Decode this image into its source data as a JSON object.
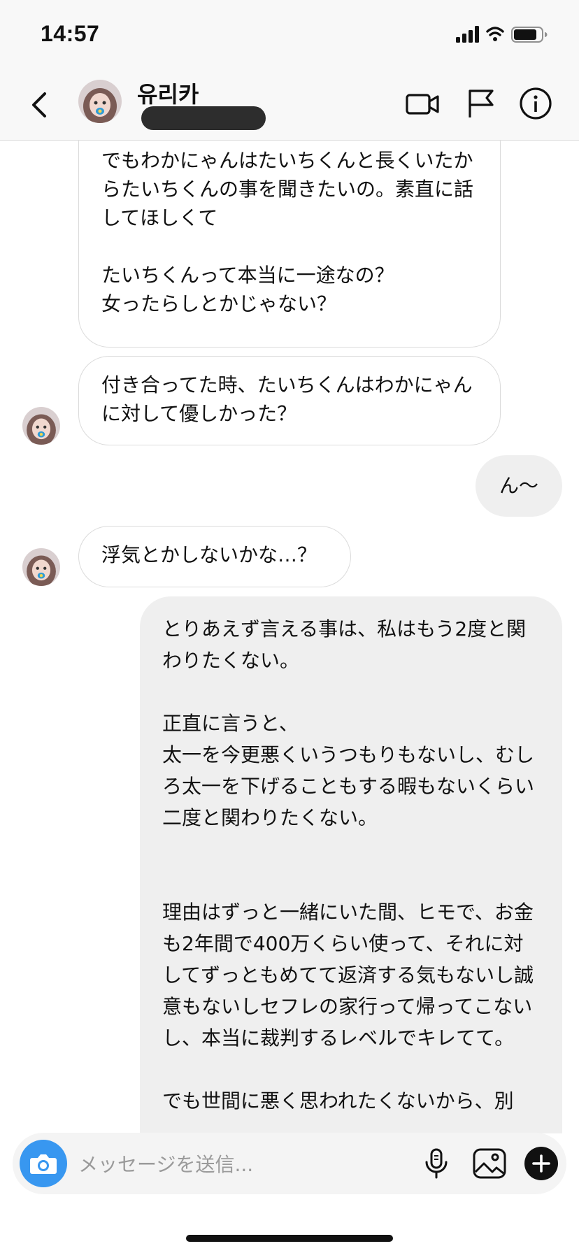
{
  "status": {
    "time": "14:57"
  },
  "header": {
    "name": "유리카"
  },
  "composer": {
    "placeholder": "メッセージを送信..."
  },
  "messages": [
    {
      "dir": "in",
      "text": "でもわかにゃんはたいちくんと長くいたからたいちくんの事を聞きたいの。素直に話してほしくて\n\nたいちくんって本当に一途なの？\n女ったらしとかじゃない？"
    },
    {
      "dir": "in",
      "text": "付き合ってた時、たいちくんはわかにゃんに対して優しかった？"
    },
    {
      "dir": "out",
      "text": "ん〜"
    },
    {
      "dir": "in",
      "text": "浮気とかしないかな…？"
    },
    {
      "dir": "out",
      "text": "とりあえず言える事は、私はもう2度と関わりたくない。\n\n正直に言うと、\n太一を今更悪くいうつもりもないし、むしろ太一を下げることもする暇もないくらい二度と関わりたくない。\n\n\n理由はずっと一緒にいた間、ヒモで、お金も2年間で400万くらい使って、それに対してずっともめてて返済する気もないし誠意もないしセフレの家行って帰ってこないし、本当に裁判するレベルでキレてて。\n\nでも世間に悪く思われたくないから、別"
    }
  ]
}
